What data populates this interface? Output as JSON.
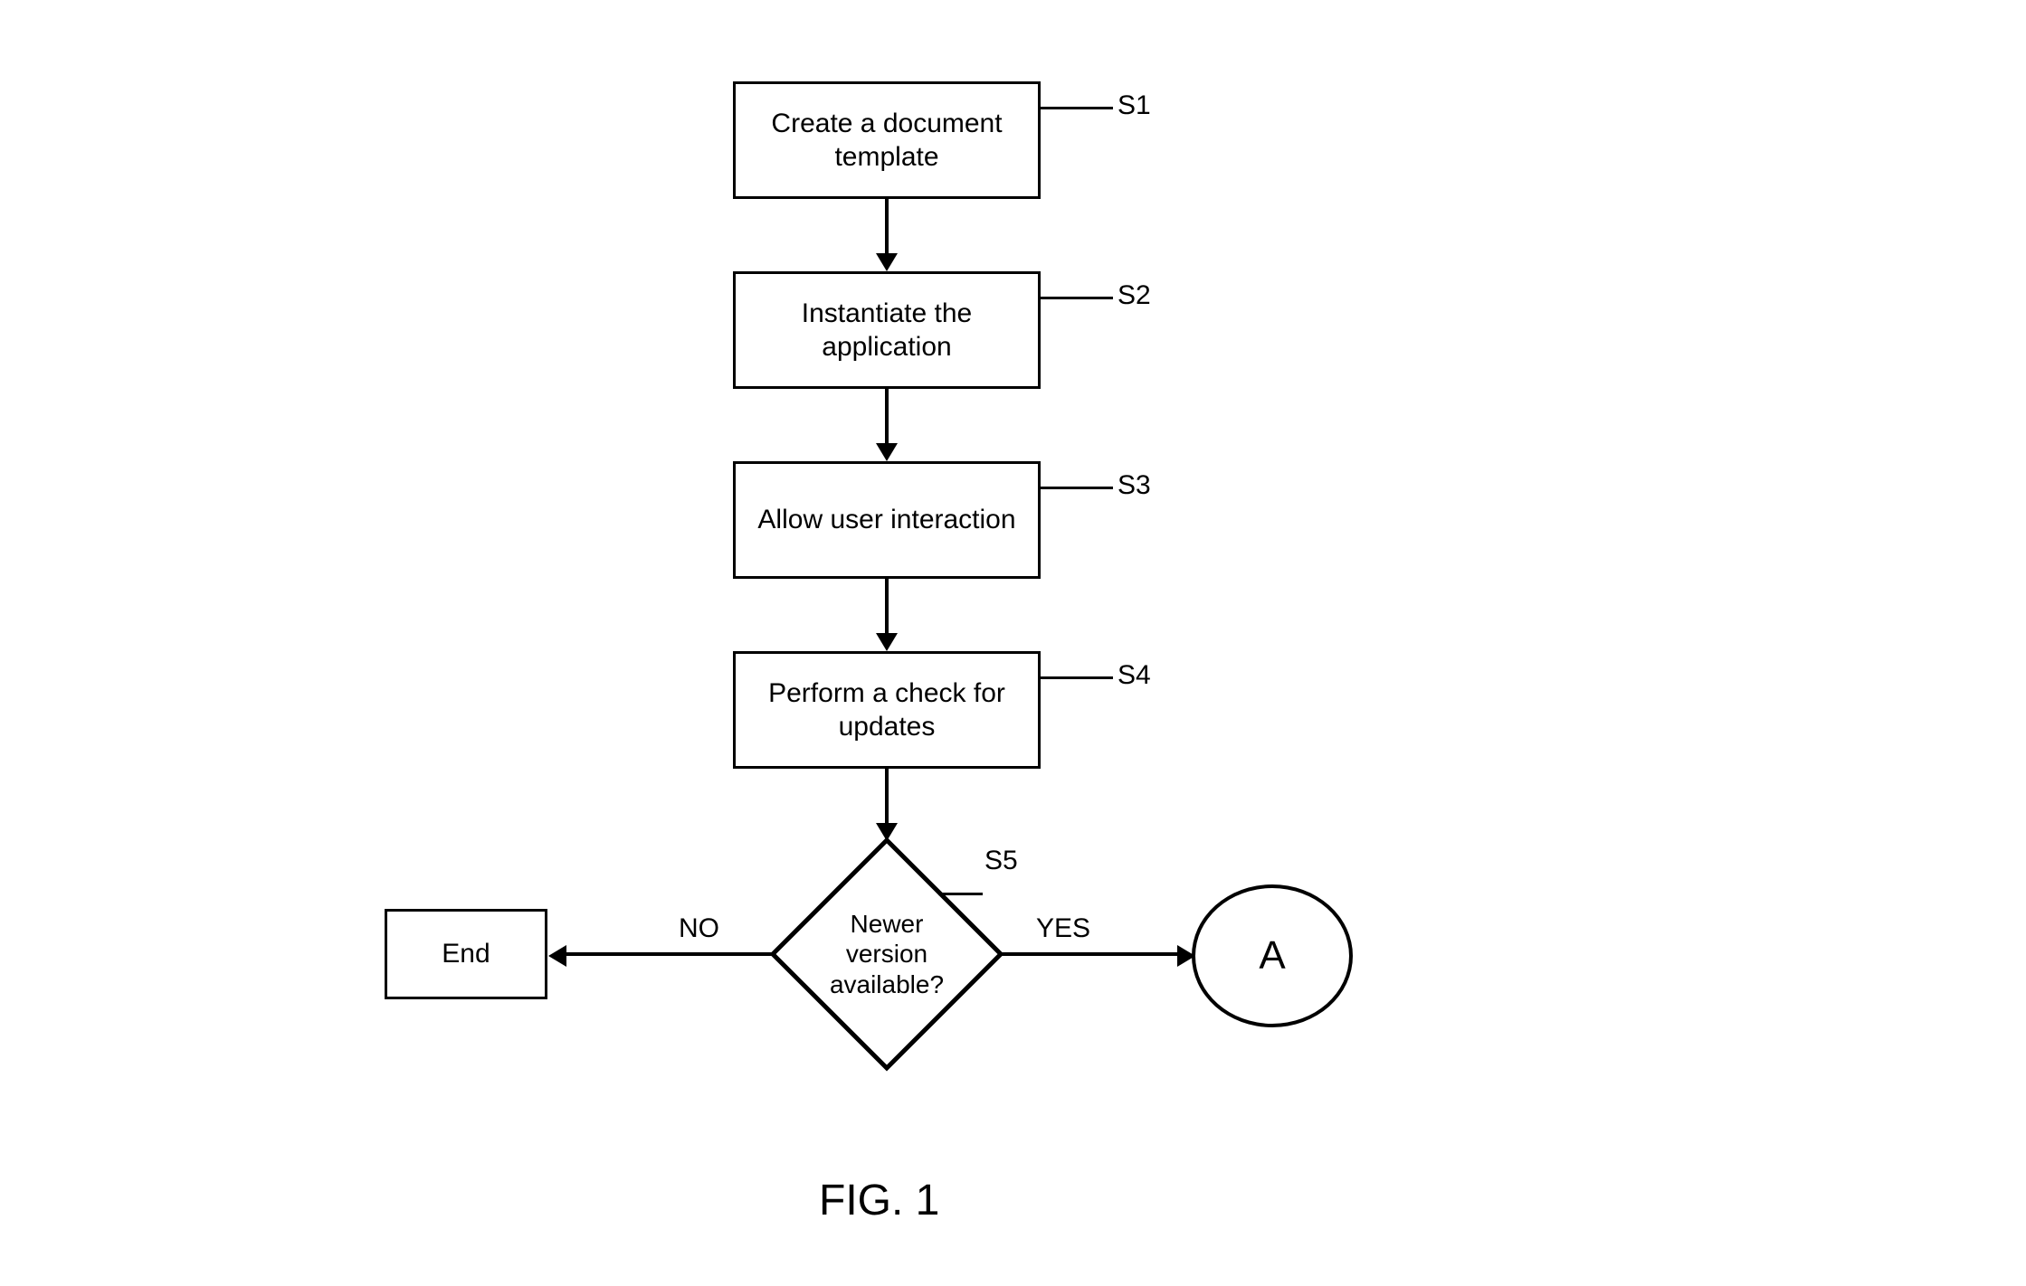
{
  "diagram": {
    "title": "FIG. 1",
    "steps": {
      "s1": {
        "label": "S1",
        "text": "Create a document template"
      },
      "s2": {
        "label": "S2",
        "text": "Instantiate the application"
      },
      "s3": {
        "label": "S3",
        "text": "Allow user interaction"
      },
      "s4": {
        "label": "S4",
        "text": "Perform a check for updates"
      },
      "s5": {
        "label": "S5",
        "text": "Newer version available?"
      }
    },
    "branches": {
      "no": "NO",
      "yes": "YES"
    },
    "terminals": {
      "end": "End",
      "connector_a": "A"
    }
  }
}
